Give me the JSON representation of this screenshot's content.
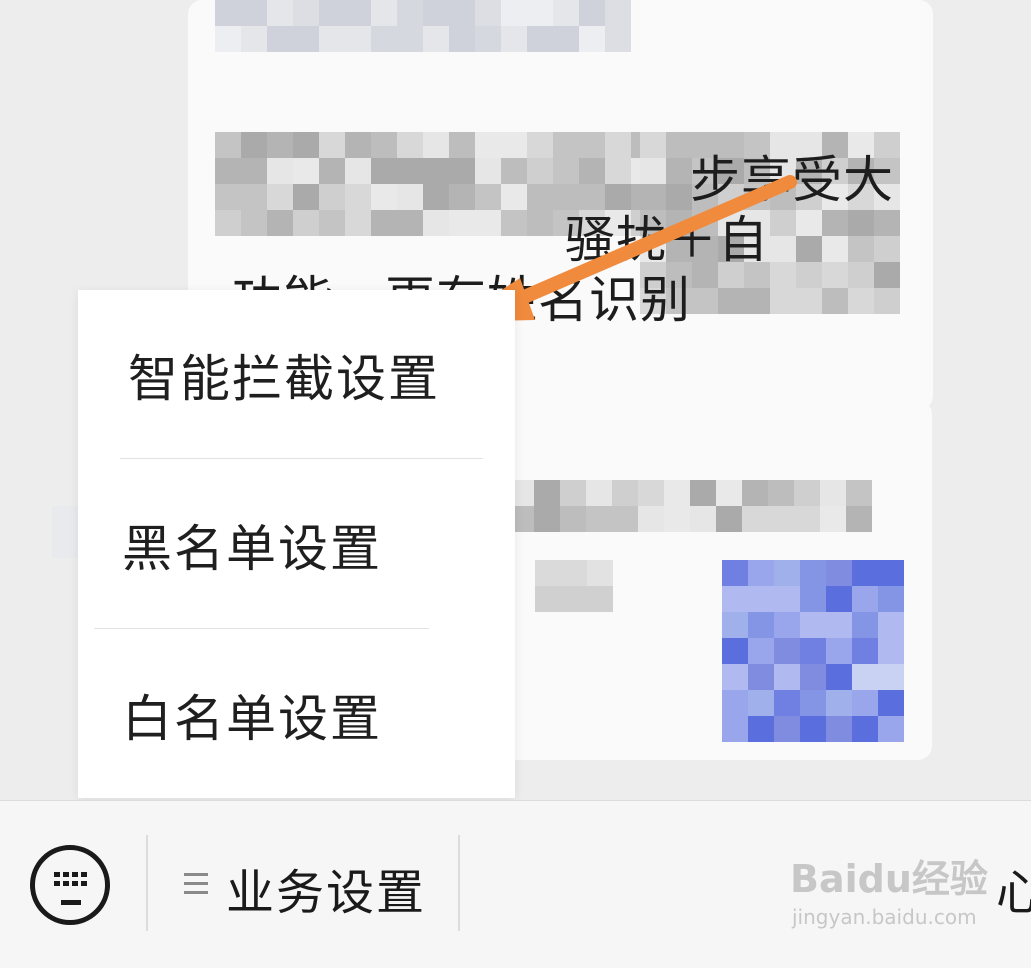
{
  "menu": {
    "items": [
      {
        "label": "智能拦截设置"
      },
      {
        "label": "黑名单设置"
      },
      {
        "label": "白名单设置"
      }
    ]
  },
  "bottom_bar": {
    "keyboard_icon": "keyboard-icon",
    "menu_icon": "hamburger-icon",
    "business_settings_label": "业务设置",
    "right_partial_text": "心"
  },
  "background_message": {
    "line1": "步享受大",
    "line2": "骚扰＋自",
    "line3": "功能，更有姓名识别"
  },
  "annotation": {
    "arrow_color": "#f08a3c"
  },
  "watermark": {
    "brand": "Baidu经验",
    "url": "jingyan.baidu.com"
  },
  "colors": {
    "background": "#ededed",
    "menu_bg": "#ffffff",
    "accent_blue": "#6b7be0"
  }
}
